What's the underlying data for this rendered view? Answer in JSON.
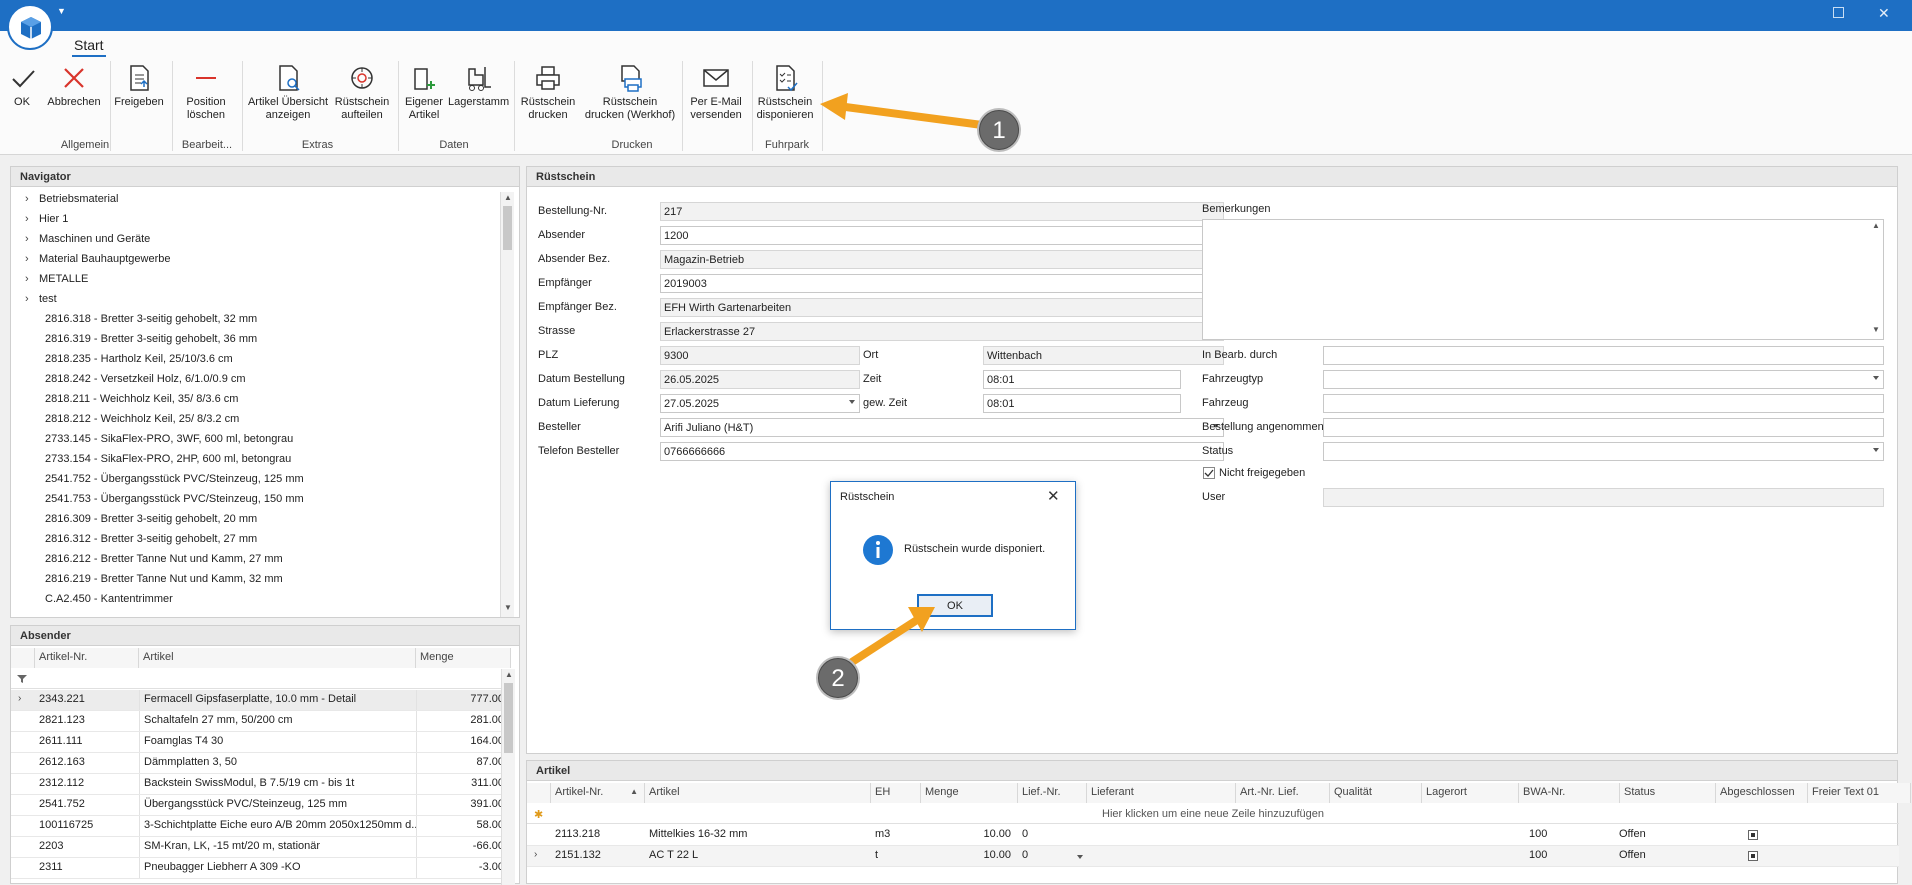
{
  "ribbon": {
    "tab": "Start",
    "buttons": {
      "ok": "OK",
      "cancel": "Abbrechen",
      "release": "Freigeben",
      "delete_pos": [
        "Position",
        "löschen"
      ],
      "article_overview": [
        "Artikel Übersicht",
        "anzeigen"
      ],
      "split": [
        "Rüstschein",
        "aufteilen"
      ],
      "own_article": [
        "Eigener",
        "Artikel"
      ],
      "warehouse": "Lagerstamm",
      "print": [
        "Rüstschein",
        "drucken"
      ],
      "print_werkhof": [
        "Rüstschein",
        "drucken (Werkhof)"
      ],
      "email": [
        "Per E-Mail",
        "versenden"
      ],
      "dispatch": [
        "Rüstschein",
        "disponieren"
      ]
    },
    "groups": {
      "allgemein": "Allgemein",
      "bearbeiten": "Bearbeit...",
      "extras": "Extras",
      "daten": "Daten",
      "drucken": "Drucken",
      "fuhrpark": "Fuhrpark"
    }
  },
  "navigator": {
    "title": "Navigator",
    "folders": [
      "Betriebsmaterial",
      "Hier 1",
      "Maschinen und Geräte",
      "Material Bauhauptgewerbe",
      "METALLE",
      "test"
    ],
    "items": [
      "2816.318 - Bretter 3-seitig gehobelt, 32 mm",
      "2816.319 - Bretter 3-seitig gehobelt, 36 mm",
      "2818.235 - Hartholz Keil, 25/10/3.6 cm",
      "2818.242 - Versetzkeil Holz, 6/1.0/0.9 cm",
      "2818.211 - Weichholz Keil, 35/ 8/3.6 cm",
      "2818.212 - Weichholz Keil, 25/ 8/3.2 cm",
      "2733.145 - SikaFlex-PRO, 3WF, 600 ml, betongrau",
      "2733.154 - SikaFlex-PRO, 2HP, 600 ml, betongrau",
      "2541.752 - Übergangsstück PVC/Steinzeug, 125 mm",
      "2541.753 - Übergangsstück PVC/Steinzeug, 150 mm",
      "2816.309 - Bretter 3-seitig gehobelt, 20 mm",
      "2816.312 - Bretter 3-seitig gehobelt, 27 mm",
      "2816.212 - Bretter Tanne Nut und Kamm, 27 mm",
      "2816.219 - Bretter Tanne Nut und Kamm, 32 mm",
      "C.A2.450 - Kantentrimmer"
    ]
  },
  "absender": {
    "title": "Absender",
    "columns": [
      "Artikel-Nr.",
      "Artikel",
      "Menge"
    ],
    "rows": [
      [
        "2343.221",
        "Fermacell Gipsfaserplatte, 10.0 mm - Detail",
        "777.00"
      ],
      [
        "2821.123",
        "Schaltafeln 27 mm, 50/200 cm",
        "281.00"
      ],
      [
        "2611.111",
        "Foamglas  T4   30",
        "164.00"
      ],
      [
        "2612.163",
        "Dämmplatten 3, 50",
        "87.00"
      ],
      [
        "2312.112",
        "Backstein SwissModul, B 7.5/19 cm - bis 1t",
        "311.00"
      ],
      [
        "2541.752",
        "Übergangsstück PVC/Steinzeug, 125 mm",
        "391.00"
      ],
      [
        "100116725",
        "3-Schichtplatte Eiche euro A/B 20mm 2050x1250mm d...",
        "58.00"
      ],
      [
        "2203",
        "SM-Kran, LK, -15 mt/20 m, stationär",
        "-66.00"
      ],
      [
        "2311",
        "Pneubagger Liebherr A 309 -KO",
        "-3.00"
      ]
    ]
  },
  "ruestschein": {
    "title": "Rüstschein",
    "labels": {
      "bestellung_nr": "Bestellung-Nr.",
      "absender": "Absender",
      "absender_bez": "Absender Bez.",
      "empfaenger": "Empfänger",
      "empfaenger_bez": "Empfänger Bez.",
      "strasse": "Strasse",
      "plz": "PLZ",
      "ort": "Ort",
      "datum_bestellung": "Datum Bestellung",
      "zeit": "Zeit",
      "datum_lieferung": "Datum Lieferung",
      "gew_zeit": "gew. Zeit",
      "besteller": "Besteller",
      "telefon": "Telefon Besteller",
      "bemerkungen": "Bemerkungen",
      "in_bearb": "In Bearb. durch",
      "fahrzeugtyp": "Fahrzeugtyp",
      "fahrzeug": "Fahrzeug",
      "bestellung_angenommen": "Bestellung angenommen",
      "status": "Status",
      "nicht_freigegeben": "Nicht freigegeben",
      "user": "User"
    },
    "values": {
      "bestellung_nr": "217",
      "absender": "1200",
      "absender_bez": "Magazin-Betrieb",
      "empfaenger": "2019003",
      "empfaenger_bez": "EFH Wirth Gartenarbeiten",
      "strasse": "Erlackerstrasse 27",
      "plz": "9300",
      "ort": "Wittenbach",
      "datum_bestellung": "26.05.2025",
      "zeit": "08:01",
      "datum_lieferung": "27.05.2025",
      "gew_zeit": "08:01",
      "besteller": "Arifi Juliano (H&T)",
      "telefon": "0766666666"
    }
  },
  "artikel": {
    "title": "Artikel",
    "columns": [
      "Artikel-Nr.",
      "Artikel",
      "EH",
      "Menge",
      "Lief.-Nr.",
      "Lieferant",
      "Art.-Nr. Lief.",
      "Qualität",
      "Lagerort",
      "BWA-Nr.",
      "Status",
      "Abgeschlossen",
      "Freier Text 01"
    ],
    "new_row_hint": "Hier klicken um eine neue Zeile hinzuzufügen",
    "rows": [
      [
        "2113.218",
        "Mittelkies 16-32 mm",
        "m3",
        "10.00",
        "0",
        "100",
        "Offen"
      ],
      [
        "2151.132",
        "AC T 22 L",
        "t",
        "10.00",
        "0",
        "100",
        "Offen"
      ]
    ]
  },
  "dialog": {
    "title": "Rüstschein",
    "message": "Rüstschein wurde disponiert.",
    "ok": "OK"
  },
  "callouts": [
    "1",
    "2"
  ]
}
